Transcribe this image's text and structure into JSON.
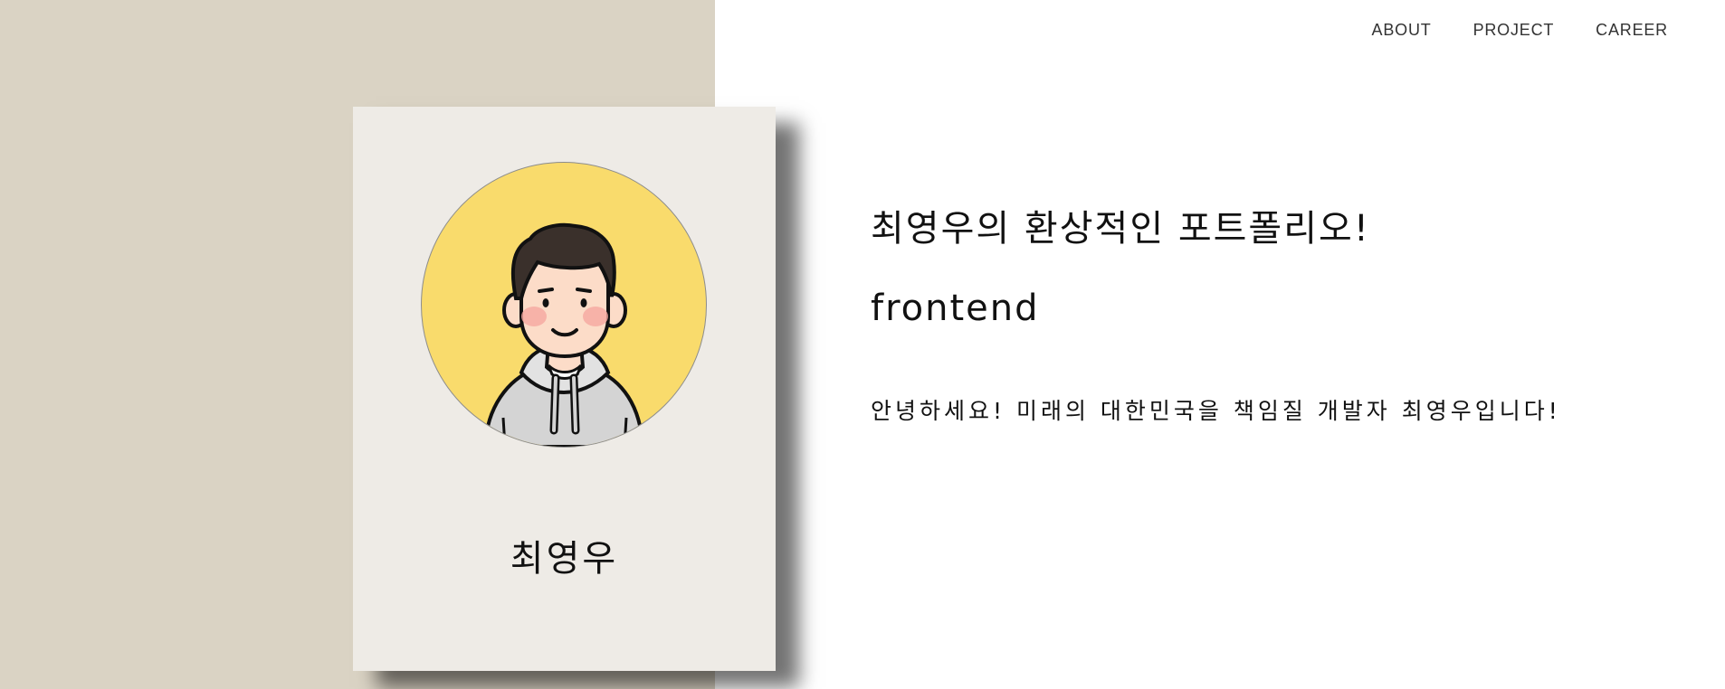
{
  "nav": {
    "items": [
      {
        "label": "ABOUT"
      },
      {
        "label": "PROJECT"
      },
      {
        "label": "CAREER"
      }
    ]
  },
  "profile": {
    "name": "최영우",
    "avatar_icon": "user-avatar-illustration"
  },
  "main": {
    "headline": "최영우의 환상적인 포트폴리오!",
    "role": "frontend",
    "intro": "안녕하세요! 미래의 대한민국을 책임질 개발자 최영우입니다!"
  },
  "colors": {
    "left_panel": "#dad3c4",
    "card": "#eeebe6",
    "avatar_bg": "#f9db6c",
    "text": "#111111"
  }
}
